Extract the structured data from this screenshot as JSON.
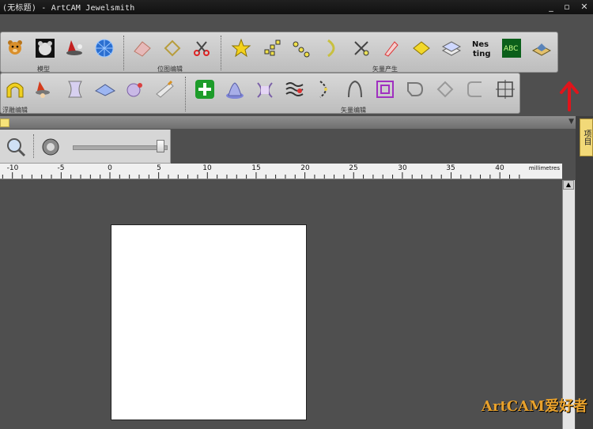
{
  "window": {
    "title": "(无标题) - ArtCAM Jewelsmith",
    "minimize_icon": "minimize-icon",
    "restore_icon": "restore-icon",
    "close_icon": "close-icon"
  },
  "toolbar1": {
    "group1_label": "模型",
    "group2_label": "位图编辑",
    "group3_label": "矢量产生"
  },
  "toolbar2": {
    "group1_label": "浮雕编辑",
    "group2_label": "矢量编辑"
  },
  "view": {
    "zoom_icon": "zoom-icon",
    "render_icon": "render-icon",
    "slider_value": 0.95
  },
  "ruler": {
    "unit": "millimetres",
    "ticks": [
      "-10",
      "-5",
      "0",
      "5",
      "10",
      "15",
      "20",
      "25",
      "30",
      "35",
      "40"
    ]
  },
  "side_panel": {
    "tab_label": "项目"
  },
  "watermark": {
    "text": "ArtCAM爱好者"
  },
  "colors": {
    "workspace": "#4f4f4f",
    "toolbar": "#cfcfcf",
    "titlebar": "#151515",
    "annotation": "#e0141b",
    "tab_accent": "#f2d978"
  }
}
